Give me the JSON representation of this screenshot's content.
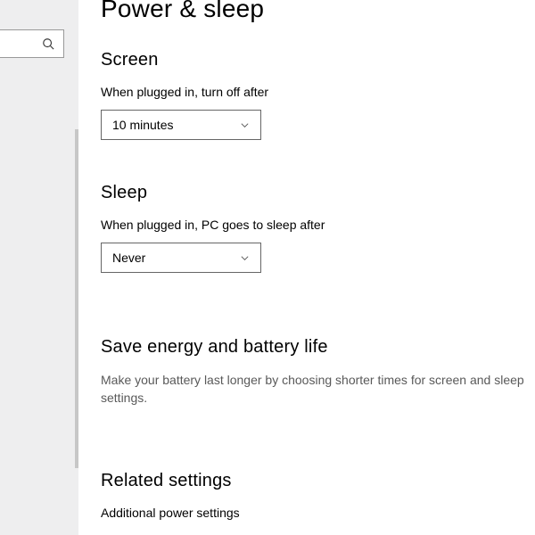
{
  "page": {
    "title": "Power & sleep"
  },
  "search": {
    "placeholder": ""
  },
  "screen": {
    "heading": "Screen",
    "plugged_label": "When plugged in, turn off after",
    "plugged_value": "10 minutes"
  },
  "sleep": {
    "heading": "Sleep",
    "plugged_label": "When plugged in, PC goes to sleep after",
    "plugged_value": "Never"
  },
  "energy": {
    "heading": "Save energy and battery life",
    "body": "Make your battery last longer by choosing shorter times for screen and sleep settings."
  },
  "related": {
    "heading": "Related settings",
    "link1": "Additional power settings"
  }
}
